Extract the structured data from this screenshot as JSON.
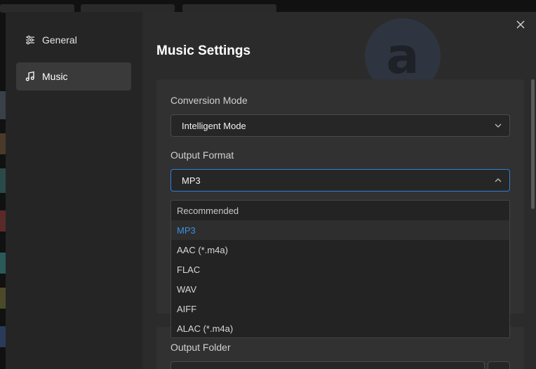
{
  "sidebar": {
    "items": [
      {
        "label": "General",
        "icon": "sliders-icon",
        "active": false
      },
      {
        "label": "Music",
        "icon": "music-note-icon",
        "active": true
      }
    ]
  },
  "main": {
    "title": "Music Settings",
    "conversion_mode": {
      "label": "Conversion Mode",
      "value": "Intelligent Mode"
    },
    "output_format": {
      "label": "Output Format",
      "value": "MP3",
      "options_header": "Recommended",
      "options": [
        "MP3",
        "AAC (*.m4a)",
        "FLAC",
        "WAV",
        "AIFF",
        "ALAC (*.m4a)"
      ],
      "selected": "MP3"
    },
    "output_folder": {
      "label": "Output Folder"
    }
  },
  "colors": {
    "accent": "#2f7fd6",
    "selected_text": "#3c8fe0",
    "background": "#2b2b2b",
    "sidebar": "#252525"
  }
}
